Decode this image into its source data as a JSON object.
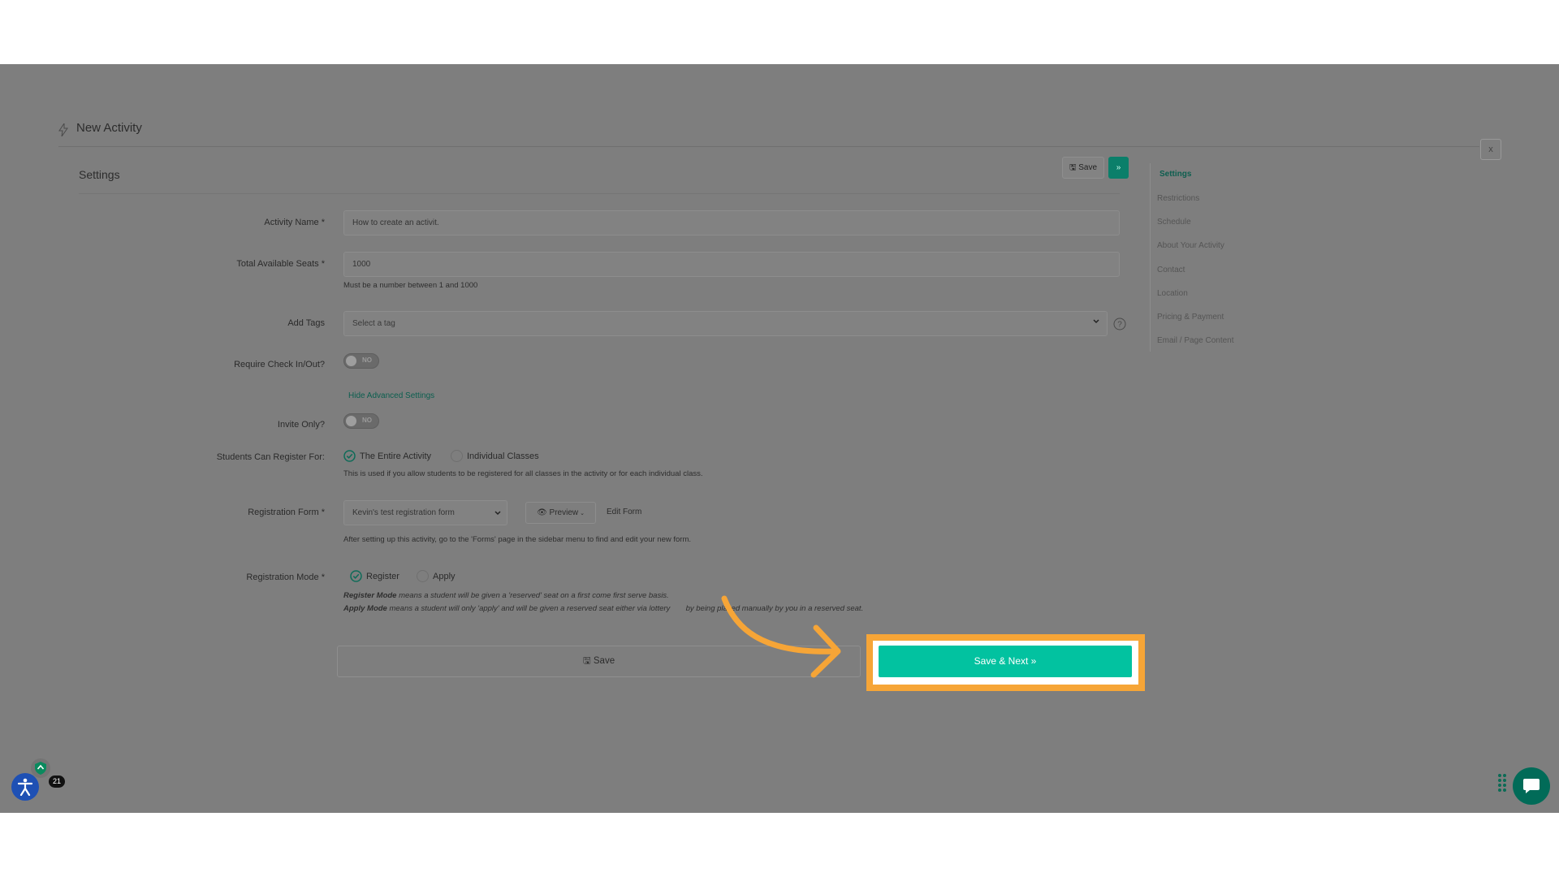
{
  "header": {
    "title": "New Activity",
    "close_label": "x"
  },
  "section": {
    "title": "Settings",
    "save_label": "Save",
    "next_label": "»"
  },
  "nav": {
    "items": [
      "Settings",
      "Restrictions",
      "Schedule",
      "About Your Activity",
      "Contact",
      "Location",
      "Pricing & Payment",
      "Email / Page Content"
    ],
    "active": "Settings"
  },
  "form": {
    "activity_name": {
      "label": "Activity Name *",
      "value": "How to create an activit."
    },
    "total_seats": {
      "label": "Total Available Seats *",
      "value": "1000",
      "hint": "Must be a number between 1 and 1000"
    },
    "tags": {
      "label": "Add Tags",
      "placeholder": "Select a tag"
    },
    "check_in": {
      "label": "Require Check In/Out?",
      "toggle": "NO"
    },
    "advanced_link": "Hide Advanced Settings",
    "invite_only": {
      "label": "Invite Only?",
      "toggle": "NO"
    },
    "register_for": {
      "label": "Students Can Register For:",
      "options": [
        "The Entire Activity",
        "Individual Classes"
      ],
      "selected": "The Entire Activity",
      "hint": "This is used if you allow students to be registered for all classes in the activity or for each individual class."
    },
    "registration_form": {
      "label": "Registration Form *",
      "value": "Kevin's test registration form",
      "preview": "Preview",
      "edit": "Edit Form",
      "hint": "After setting up this activity, go to the 'Forms' page in the sidebar menu to find and edit your new form."
    },
    "registration_mode": {
      "label": "Registration Mode *",
      "options": [
        "Register",
        "Apply"
      ],
      "selected": "Register",
      "register_title": "Register Mode",
      "register_desc": " means a student will be given a 'reserved' seat on a first come first serve basis.",
      "apply_title": "Apply Mode",
      "apply_desc": " means a student will only 'apply' and will be given a reserved seat either via lottery ",
      "apply_desc_tail": " by being placed manually by you in a reserved seat."
    }
  },
  "actions": {
    "save": "Save",
    "save_next": "Save & Next »"
  },
  "widgets": {
    "notification_count": "21"
  },
  "colors": {
    "accent": "#02c2a0",
    "highlight": "#f6a537",
    "overlay": "#7e7e7e"
  }
}
